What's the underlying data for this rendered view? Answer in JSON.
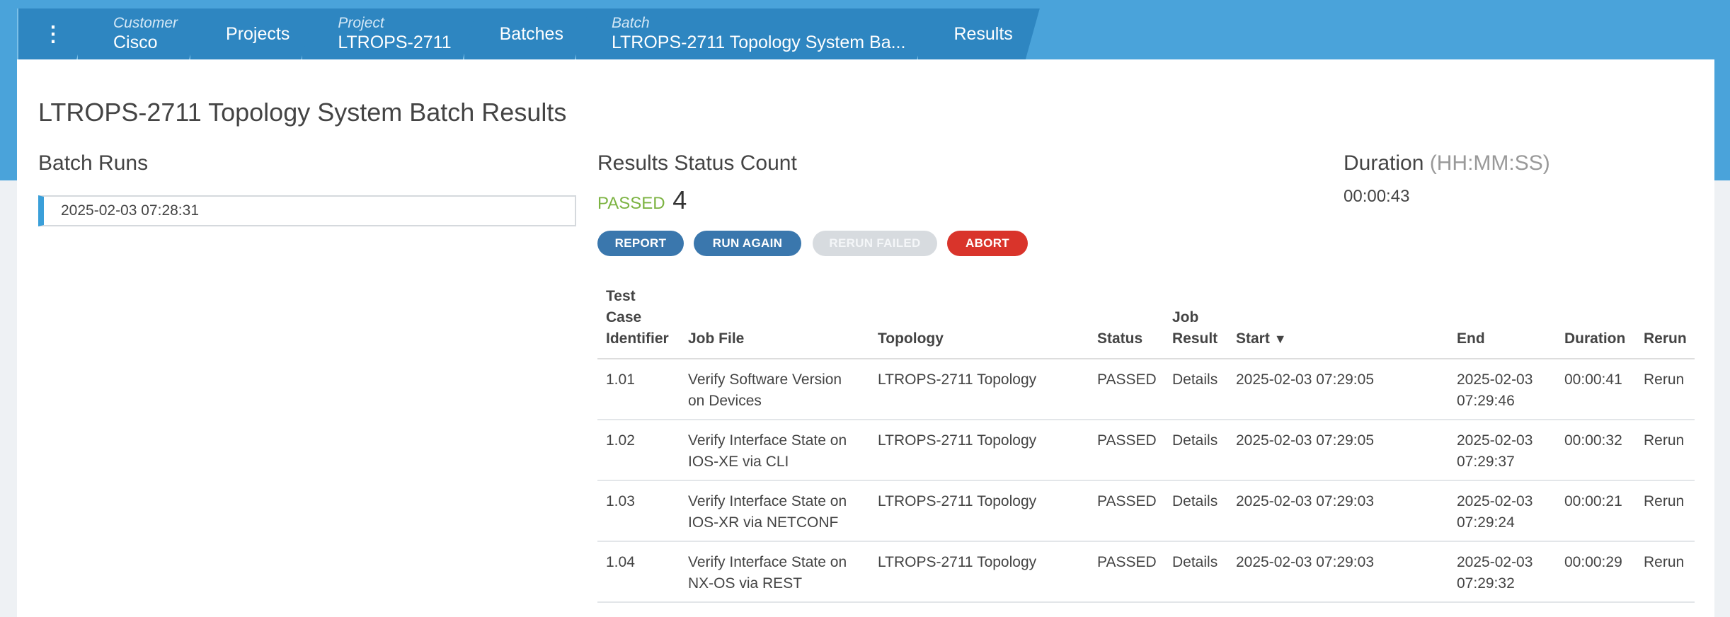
{
  "breadcrumb": {
    "menu_glyph": "⋮",
    "customer": {
      "kicker": "Customer",
      "value": "Cisco"
    },
    "projects": "Projects",
    "project": {
      "kicker": "Project",
      "value": "LTROPS-2711"
    },
    "batches": "Batches",
    "batch": {
      "kicker": "Batch",
      "value": "LTROPS-2711 Topology System Ba..."
    },
    "results": "Results"
  },
  "page_title": "LTROPS-2711 Topology System Batch Results",
  "batch_runs": {
    "title": "Batch Runs",
    "items": [
      "2025-02-03 07:28:31"
    ]
  },
  "status_count": {
    "title": "Results Status Count",
    "passed_label": "PASSED",
    "passed_count": "4"
  },
  "duration": {
    "title": "Duration",
    "unit": "(HH:MM:SS)",
    "value": "00:00:43"
  },
  "actions": {
    "report": "REPORT",
    "run_again": "RUN AGAIN",
    "rerun_failed": "RERUN FAILED",
    "abort": "ABORT"
  },
  "table": {
    "headers": {
      "test_case_1": "Test",
      "test_case_2": "Case",
      "test_case_3": "Identifier",
      "job_file": "Job File",
      "topology": "Topology",
      "status": "Status",
      "job_result_1": "Job",
      "job_result_2": "Result",
      "start": "Start",
      "sort_glyph": "▼",
      "end": "End",
      "duration": "Duration",
      "rerun": "Rerun"
    },
    "rows": [
      {
        "id": "1.01",
        "job_1": "Verify Software Version",
        "job_2": "on Devices",
        "topology": "LTROPS-2711 Topology",
        "status": "PASSED",
        "result": "Details",
        "start": "2025-02-03 07:29:05",
        "end_1": "2025-02-03",
        "end_2": "07:29:46",
        "duration": "00:00:41",
        "rerun": "Rerun"
      },
      {
        "id": "1.02",
        "job_1": "Verify Interface State on",
        "job_2": "IOS-XE via CLI",
        "topology": "LTROPS-2711 Topology",
        "status": "PASSED",
        "result": "Details",
        "start": "2025-02-03 07:29:05",
        "end_1": "2025-02-03",
        "end_2": "07:29:37",
        "duration": "00:00:32",
        "rerun": "Rerun"
      },
      {
        "id": "1.03",
        "job_1": "Verify Interface State on",
        "job_2": "IOS-XR via NETCONF",
        "topology": "LTROPS-2711 Topology",
        "status": "PASSED",
        "result": "Details",
        "start": "2025-02-03 07:29:03",
        "end_1": "2025-02-03",
        "end_2": "07:29:24",
        "duration": "00:00:21",
        "rerun": "Rerun"
      },
      {
        "id": "1.04",
        "job_1": "Verify Interface State on",
        "job_2": "NX-OS via REST",
        "topology": "LTROPS-2711 Topology",
        "status": "PASSED",
        "result": "Details",
        "start": "2025-02-03 07:29:03",
        "end_1": "2025-02-03",
        "end_2": "07:29:32",
        "duration": "00:00:29",
        "rerun": "Rerun"
      }
    ]
  },
  "colors": {
    "nav": "#2e86c1",
    "band": "#4aa3da",
    "passed": "#7cb342",
    "report_btn": "#3a77ad",
    "abort_btn": "#d9342b",
    "disabled_btn": "#d7dbdf"
  }
}
